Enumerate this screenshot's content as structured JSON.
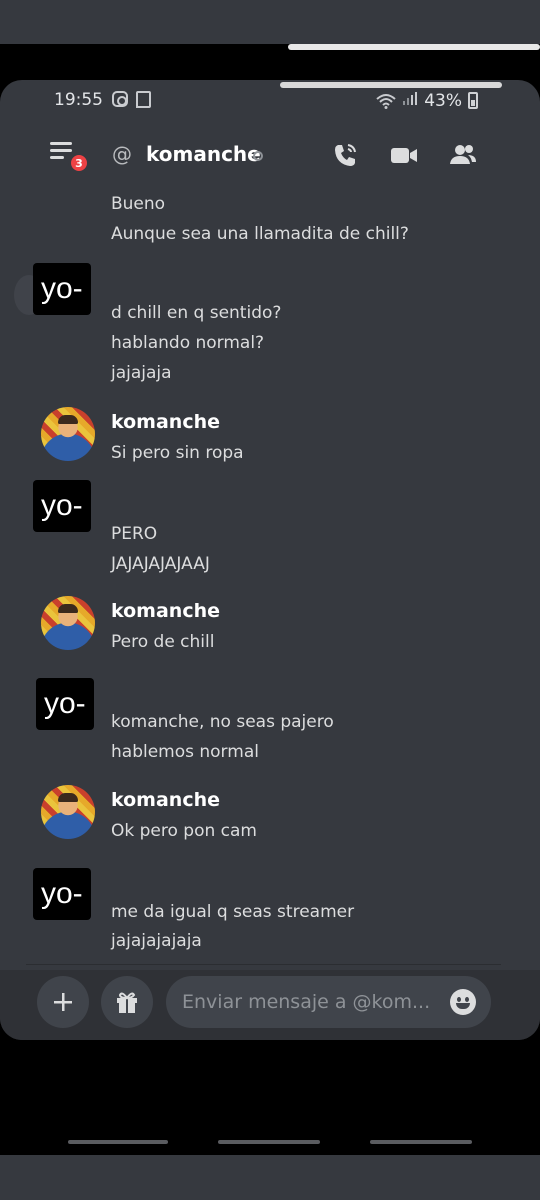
{
  "status_bar": {
    "time": "19:55",
    "battery": "43%"
  },
  "header": {
    "badge_count": "3",
    "at_symbol": "@",
    "title": "komanche"
  },
  "messages": [
    {
      "kind": "continuation",
      "lines": [
        "Bueno",
        "Aunque sea una llamadita de chill?"
      ]
    },
    {
      "kind": "self",
      "label": "yo-",
      "lines": [
        "d chill en q sentido?",
        "hablando normal?",
        "jajajaja"
      ]
    },
    {
      "kind": "other",
      "author": "komanche",
      "lines": [
        "Si pero sin ropa"
      ]
    },
    {
      "kind": "self",
      "label": "yo-",
      "lines": [
        "PERO",
        "JAJAJAJAJAAJ"
      ]
    },
    {
      "kind": "other",
      "author": "komanche",
      "lines": [
        "Pero de chill"
      ]
    },
    {
      "kind": "self",
      "label": "yo-",
      "lines": [
        "komanche, no seas pajero",
        "hablemos normal"
      ]
    },
    {
      "kind": "other",
      "author": "komanche",
      "lines": [
        "Ok pero pon cam"
      ]
    },
    {
      "kind": "self",
      "label": "yo-",
      "lines": [
        "me da igual q seas streamer",
        "jajajajajaja"
      ]
    }
  ],
  "composer": {
    "placeholder": "Enviar mensaje a @kom...",
    "add_icon": "plus-icon",
    "gift_icon": "gift-icon",
    "emoji_icon": "emoji-icon"
  },
  "icons": {
    "menu": "hamburger-menu-icon",
    "call": "phone-call-icon",
    "video": "video-camera-icon",
    "members": "members-icon"
  },
  "colors": {
    "background": "#36393f",
    "composer": "#2f3136",
    "input": "#40444b",
    "badge": "#ed4245",
    "text": "#dcddde"
  }
}
